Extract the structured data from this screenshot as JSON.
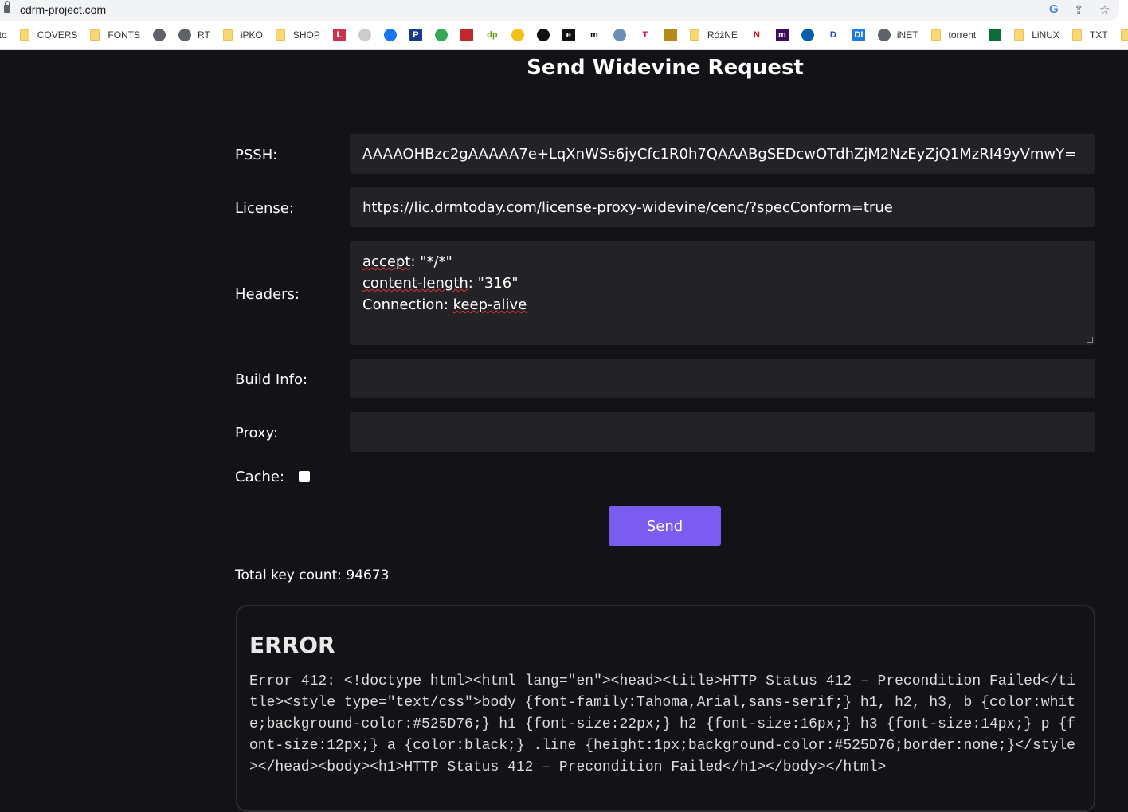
{
  "browser": {
    "url": "cdrm-project.com",
    "bookmarks": [
      {
        "label": "oto",
        "icon": "none"
      },
      {
        "label": "COVERS",
        "icon": "folder"
      },
      {
        "label": "FONTS",
        "icon": "folder"
      },
      {
        "label": "",
        "icon": "globe"
      },
      {
        "label": "RT",
        "icon": "globe"
      },
      {
        "label": "iPKO",
        "icon": "folder"
      },
      {
        "label": "SHOP",
        "icon": "folder"
      },
      {
        "label": "",
        "icon": "sq",
        "color": "#c8344e",
        "glyph": "L"
      },
      {
        "label": "",
        "icon": "fav",
        "color": "#ccc"
      },
      {
        "label": "",
        "icon": "fav",
        "color": "#1877f2"
      },
      {
        "label": "",
        "icon": "sq",
        "color": "#1a3a8c",
        "glyph": "P"
      },
      {
        "label": "",
        "icon": "fav",
        "color": "#34a853"
      },
      {
        "label": "",
        "icon": "sq",
        "color": "#c0282e"
      },
      {
        "label": "",
        "icon": "sq",
        "color": "#fff",
        "glyph": "dp",
        "fg": "#6aa01a"
      },
      {
        "label": "",
        "icon": "fav",
        "color": "#f5c017"
      },
      {
        "label": "",
        "icon": "fav",
        "color": "#111"
      },
      {
        "label": "",
        "icon": "sq",
        "color": "#111",
        "glyph": "e"
      },
      {
        "label": "",
        "icon": "sq",
        "color": "#fff",
        "glyph": "m",
        "fg": "#000"
      },
      {
        "label": "",
        "icon": "fav",
        "color": "#6b8fb3"
      },
      {
        "label": "",
        "icon": "sq",
        "color": "#fff",
        "glyph": "T",
        "fg": "#e20074"
      },
      {
        "label": "",
        "icon": "sq",
        "color": "#b58a1a"
      },
      {
        "label": "RóżNE",
        "icon": "folder"
      },
      {
        "label": "",
        "icon": "sq",
        "color": "#fff",
        "glyph": "N",
        "fg": "#e50914"
      },
      {
        "label": "",
        "icon": "sq",
        "color": "#3b0a5e",
        "glyph": "m"
      },
      {
        "label": "",
        "icon": "fav",
        "color": "#0b5fa8"
      },
      {
        "label": "",
        "icon": "sq",
        "color": "#fff",
        "glyph": "D",
        "fg": "#2a3bdc"
      },
      {
        "label": "",
        "icon": "sq",
        "color": "#1e7be0",
        "glyph": "DI"
      },
      {
        "label": "iNET",
        "icon": "globe"
      },
      {
        "label": "torrent",
        "icon": "folder"
      },
      {
        "label": "",
        "icon": "sq",
        "color": "#0d6b3a"
      },
      {
        "label": "LiNUX",
        "icon": "folder"
      },
      {
        "label": "TXT",
        "icon": "folder"
      },
      {
        "label": "",
        "icon": "folder"
      }
    ]
  },
  "page": {
    "title": "Send Widevine Request",
    "pssh_label": "PSSH:",
    "pssh": "AAAAOHBzc2gAAAAA7e+LqXnWSs6jyCfc1R0h7QAAABgSEDcwOTdhZjM2NzEyZjQ1MzRI49yVmwY=",
    "license_label": "License:",
    "license": "https://lic.drmtoday.com/license-proxy-widevine/cenc/?specConform=true",
    "headers_label": "Headers:",
    "headers": [
      {
        "key": "accept",
        "value": "\"*/*\""
      },
      {
        "key": "content-length",
        "value": "\"316\""
      },
      {
        "key": "Connection",
        "value": "keep-alive"
      }
    ],
    "build_label": "Build Info:",
    "build": "",
    "proxy_label": "Proxy:",
    "proxy": "",
    "cache_label": "Cache:",
    "cache_checked": false,
    "send_label": "Send",
    "count_label": "Total key count:",
    "count": "94673",
    "error_title": "ERROR",
    "error_text": "Error 412: <!doctype html><html lang=\"en\"><head><title>HTTP Status 412 – Precondition Failed</title><style type=\"text/css\">body {font-family:Tahoma,Arial,sans-serif;} h1, h2, h3, b {color:white;background-color:#525D76;} h1 {font-size:22px;} h2 {font-size:16px;} h3 {font-size:14px;} p {font-size:12px;} a {color:black;} .line {height:1px;background-color:#525D76;border:none;}</style></head><body><h1>HTTP Status 412 – Precondition Failed</h1></body></html>"
  }
}
